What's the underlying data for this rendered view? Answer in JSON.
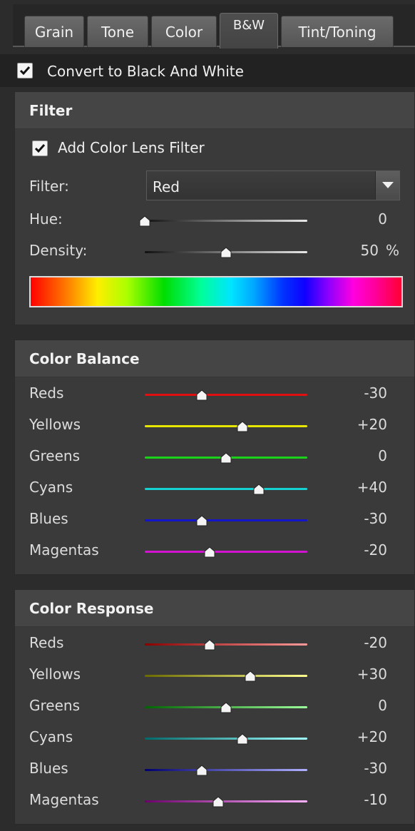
{
  "tabs": [
    {
      "label": "Grain"
    },
    {
      "label": "Tone"
    },
    {
      "label": "Color"
    },
    {
      "label": "B&W",
      "active": true
    },
    {
      "label": "Tint/Toning"
    }
  ],
  "convert": {
    "label": "Convert to Black And White",
    "checked": true
  },
  "filter_section": {
    "title": "Filter",
    "add_filter": {
      "label": "Add Color Lens Filter",
      "checked": true
    },
    "filter_label": "Filter:",
    "filter_value": "Red",
    "hue": {
      "label": "Hue:",
      "value": "0",
      "fraction": 0.0
    },
    "density": {
      "label": "Density:",
      "value": "50",
      "unit": "%",
      "fraction": 0.5
    }
  },
  "color_balance": {
    "title": "Color Balance",
    "rows": [
      {
        "label": "Reds",
        "value": "-30",
        "fraction": 0.35,
        "color": "#e01010"
      },
      {
        "label": "Yellows",
        "value": "+20",
        "fraction": 0.6,
        "color": "#e6e600"
      },
      {
        "label": "Greens",
        "value": "0",
        "fraction": 0.5,
        "color": "#19d219"
      },
      {
        "label": "Cyans",
        "value": "+40",
        "fraction": 0.7,
        "color": "#14d2d2"
      },
      {
        "label": "Blues",
        "value": "-30",
        "fraction": 0.35,
        "color": "#1414c8"
      },
      {
        "label": "Magentas",
        "value": "-20",
        "fraction": 0.4,
        "color": "#d214d2"
      }
    ]
  },
  "color_response": {
    "title": "Color Response",
    "rows": [
      {
        "label": "Reds",
        "value": "-20",
        "fraction": 0.4,
        "color_dark": "#8a0000",
        "color_light": "#ff9a9a"
      },
      {
        "label": "Yellows",
        "value": "+30",
        "fraction": 0.65,
        "color_dark": "#6a6a00",
        "color_light": "#ffff90"
      },
      {
        "label": "Greens",
        "value": "0",
        "fraction": 0.5,
        "color_dark": "#006400",
        "color_light": "#9cff9c"
      },
      {
        "label": "Cyans",
        "value": "+20",
        "fraction": 0.6,
        "color_dark": "#006a6a",
        "color_light": "#a0ffff"
      },
      {
        "label": "Blues",
        "value": "-30",
        "fraction": 0.35,
        "color_dark": "#00006e",
        "color_light": "#b0b0ff"
      },
      {
        "label": "Magentas",
        "value": "-10",
        "fraction": 0.45,
        "color_dark": "#6a006a",
        "color_light": "#ffb0ff"
      }
    ]
  }
}
